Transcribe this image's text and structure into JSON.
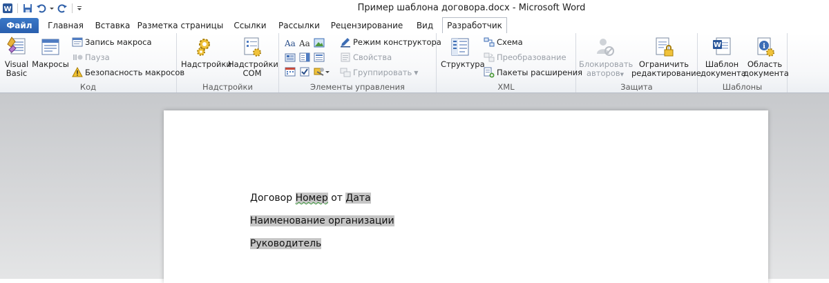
{
  "window": {
    "title": "Пример шаблона договора.docx  -  Microsoft Word"
  },
  "tabs": [
    {
      "label": "Файл"
    },
    {
      "label": "Главная"
    },
    {
      "label": "Вставка"
    },
    {
      "label": "Разметка страницы"
    },
    {
      "label": "Ссылки"
    },
    {
      "label": "Рассылки"
    },
    {
      "label": "Рецензирование"
    },
    {
      "label": "Вид"
    },
    {
      "label": "Разработчик"
    }
  ],
  "active_tab": "Разработчик",
  "groups": {
    "code": {
      "label": "Код",
      "visual_basic_1": "Visual",
      "visual_basic_2": "Basic",
      "macros": "Макросы",
      "record_macro": "Запись макроса",
      "pause": "Пауза",
      "macro_security": "Безопасность макросов"
    },
    "addins": {
      "label": "Надстройки",
      "addins": "Надстройки",
      "com_1": "Надстройки",
      "com_2": "COM"
    },
    "controls": {
      "label": "Элементы управления",
      "design_mode": "Режим конструктора",
      "properties": "Свойства",
      "group": "Группировать"
    },
    "xml": {
      "label": "XML",
      "structure": "Структура",
      "schema": "Схема",
      "transform": "Преобразование",
      "expansion_packs": "Пакеты расширения"
    },
    "protect": {
      "label": "Защита",
      "block_1": "Блокировать",
      "block_2": "авторов",
      "restrict_1": "Ограничить",
      "restrict_2": "редактирование"
    },
    "templates": {
      "label": "Шаблоны",
      "doc_template_1": "Шаблон",
      "doc_template_2": "документа",
      "doc_panel_1": "Область",
      "doc_panel_2": "документа"
    }
  },
  "document": {
    "line1_text": "Договор",
    "line1_field1": "Номер",
    "line1_mid": "от",
    "line1_field2": "Дата",
    "line2_field": "Наименование организации",
    "line3_field": "Руководитель"
  },
  "colors": {
    "file_tab": "#2a5fae",
    "field_shading": "#c6c6c6"
  }
}
